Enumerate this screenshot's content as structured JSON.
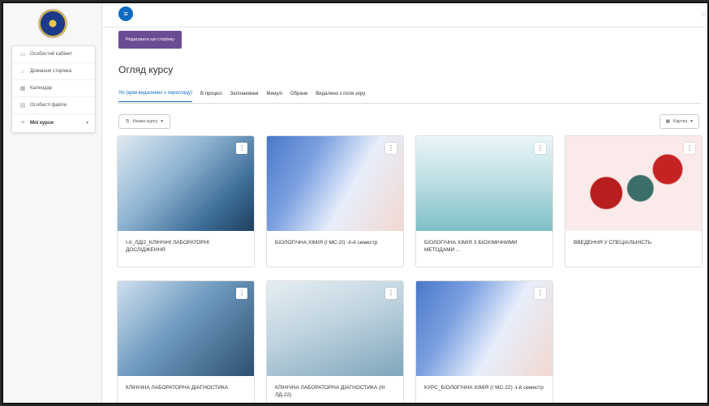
{
  "sidebar": {
    "items": [
      {
        "label": "Особистий кабінет",
        "icon": "dashboard-icon",
        "glyph": "▭"
      },
      {
        "label": "Домашня сторінка",
        "icon": "home-icon",
        "glyph": "⌂"
      },
      {
        "label": "Календар",
        "icon": "calendar-icon",
        "glyph": "▦"
      },
      {
        "label": "Особисті файли",
        "icon": "file-icon",
        "glyph": "▤"
      },
      {
        "label": "Мої курси",
        "icon": "courses-icon",
        "glyph": "≡"
      }
    ]
  },
  "topbar": {
    "menu_glyph": "≡",
    "message_glyph": "◌"
  },
  "main": {
    "edit_button": "Редагувати цю сторінку",
    "page_title": "Огляд курсу",
    "tabs": [
      {
        "label": "Усі (крім видалених з перегляду)",
        "active": true
      },
      {
        "label": "В процесі"
      },
      {
        "label": "Заплановані"
      },
      {
        "label": "Минулі"
      },
      {
        "label": "Обране"
      },
      {
        "label": "Видалено з поля зору"
      }
    ],
    "sort_label": "Назва курсу",
    "view_label": "Картка",
    "accent_color": "#0f6cbf",
    "button_color": "#6a4c93"
  },
  "courses": [
    {
      "title": "І-ІІ_ЛДІ2_КЛІНІЧНІ ЛАБОРАТОРНІ ДОСЛІДЖЕННЯ"
    },
    {
      "title": "БІОЛОГІЧНА ХІМІЯ (І МС-2І) -ІІ-й семестр"
    },
    {
      "title": "БІОЛОГІЧНА ХІМІЯ З БІОХІМІЧНИМИ МЕТОДАМИ ..."
    },
    {
      "title": "ВВЕДЕННЯ У СПЕЦІАЛЬНІСТЬ"
    },
    {
      "title": "КЛІНІЧНА ЛАБОРАТОРНА ДІАГНОСТИКА"
    },
    {
      "title": "КЛІНІЧНА ЛАБОРАТОРНА ДІАГНОСТИКА (ІІІ ЛД-22)"
    },
    {
      "title": "КУРС_БІОЛОГІЧНА ХІМІЯ (І МС-22) -І-й семестр"
    }
  ]
}
